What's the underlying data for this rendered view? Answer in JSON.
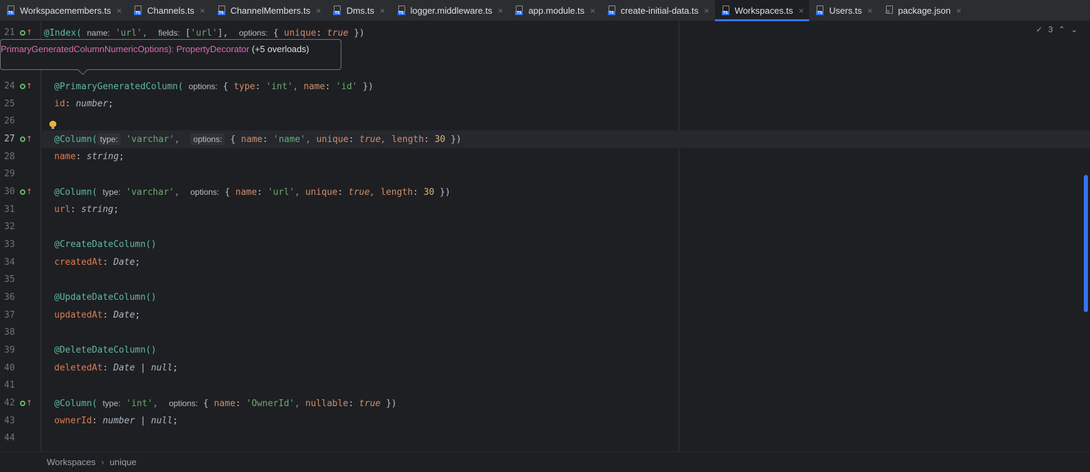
{
  "tabs": [
    {
      "label": "Workspacemembers.ts",
      "icon": "ts-file-icon",
      "active": false
    },
    {
      "label": "Channels.ts",
      "icon": "ts-file-icon",
      "active": false
    },
    {
      "label": "ChannelMembers.ts",
      "icon": "ts-file-icon",
      "active": false
    },
    {
      "label": "Dms.ts",
      "icon": "ts-file-icon",
      "active": false
    },
    {
      "label": "logger.middleware.ts",
      "icon": "ts-file-icon",
      "active": false
    },
    {
      "label": "app.module.ts",
      "icon": "ts-file-icon",
      "active": false
    },
    {
      "label": "create-initial-data.ts",
      "icon": "ts-file-icon",
      "active": false
    },
    {
      "label": "Workspaces.ts",
      "icon": "ts-file-icon",
      "active": true
    },
    {
      "label": "Users.ts",
      "icon": "ts-file-icon",
      "active": false
    },
    {
      "label": "package.json",
      "icon": "json-file-icon",
      "active": false
    }
  ],
  "close_glyph": "×",
  "inspection": {
    "count": "3",
    "up": "⌃",
    "down": "⌄"
  },
  "tooltip": {
    "part1": "PrimaryGeneratedColumnNumericOptions):",
    "part2": "PropertyDecorator",
    "part3": "(+5 overloads)"
  },
  "line_numbers": [
    "21",
    "24",
    "25",
    "26",
    "27",
    "28",
    "29",
    "30",
    "31",
    "32",
    "33",
    "34",
    "35",
    "36",
    "37",
    "38",
    "39",
    "40",
    "41",
    "42",
    "43",
    "44"
  ],
  "code": {
    "l21": {
      "ann": "@Index(",
      "h1": "name:",
      "s1": "'url',",
      "h2": "fields:",
      "p1": "[",
      "s2": "'url'",
      "p2": "],",
      "h3": "options:",
      "p3": "{",
      "k1": "unique",
      "p4": ":",
      "v1": "true",
      "p5": "})"
    },
    "l24": {
      "ann": "@PrimaryGeneratedColumn(",
      "h1": "options:",
      "p1": "{",
      "k1": "type",
      "p2": ":",
      "s1": "'int',",
      "k2": "name",
      "p3": ":",
      "s2": "'id'",
      "p4": "})"
    },
    "l25": {
      "f": "id",
      "p": ":",
      "t": "number",
      "e": ";"
    },
    "l27": {
      "ann": "@Column(",
      "h1": "type:",
      "s1": "'varchar',",
      "h2": "options:",
      "p1": "{",
      "k1": "name",
      "p2": ":",
      "s2": "'name',",
      "k2": "unique",
      "p3": ":",
      "v1": "true,",
      "k3": "length",
      "p4": ":",
      "n1": "30",
      "p5": "})"
    },
    "l28": {
      "f": "name",
      "p": ":",
      "t": "string",
      "e": ";"
    },
    "l30": {
      "ann": "@Column(",
      "h1": "type:",
      "s1": "'varchar',",
      "h2": "options:",
      "p1": "{",
      "k1": "name",
      "p2": ":",
      "s2": "'url',",
      "k2": "unique",
      "p3": ":",
      "v1": "true,",
      "k3": "length",
      "p4": ":",
      "n1": "30",
      "p5": "})"
    },
    "l31": {
      "f": "url",
      "p": ":",
      "t": "string",
      "e": ";"
    },
    "l33": {
      "ann": "@CreateDateColumn()"
    },
    "l34": {
      "f": "createdAt",
      "p": ":",
      "t": "Date",
      "e": ";"
    },
    "l36": {
      "ann": "@UpdateDateColumn()"
    },
    "l37": {
      "f": "updatedAt",
      "p": ":",
      "t": "Date",
      "e": ";"
    },
    "l39": {
      "ann": "@DeleteDateColumn()"
    },
    "l40": {
      "f": "deletedAt",
      "p": ":",
      "t": "Date",
      "pipe": "|",
      "t2": "null",
      "e": ";"
    },
    "l42": {
      "ann": "@Column(",
      "h1": "type:",
      "s1": "'int',",
      "h2": "options:",
      "p1": "{",
      "k1": "name",
      "p2": ":",
      "s2": "'OwnerId',",
      "k2": "nullable",
      "p3": ":",
      "v1": "true",
      "p4": "})"
    },
    "l43": {
      "f": "ownerId",
      "p": ":",
      "t": "number",
      "pipe": "|",
      "t2": "null",
      "e": ";"
    }
  },
  "breadcrumb": {
    "items": [
      "Workspaces",
      "unique"
    ],
    "sep": "›"
  },
  "colors": {
    "accent": "#3574f0",
    "annotation": "#5fb8a5",
    "string": "#6aab73",
    "keyword": "#cf8e6d",
    "background": "#1e1f22"
  }
}
